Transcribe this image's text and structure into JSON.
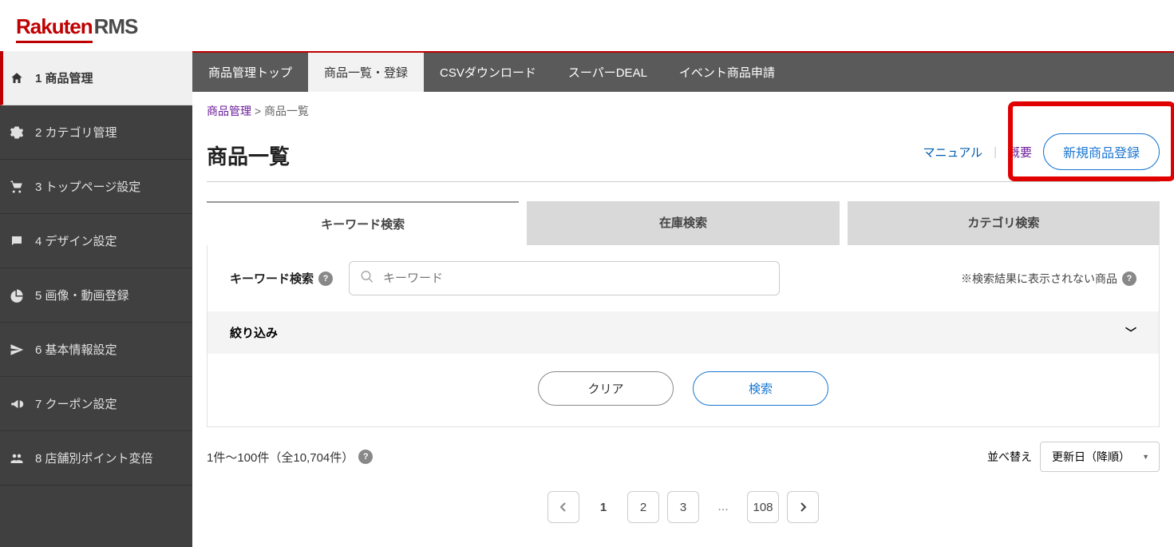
{
  "brand": {
    "name1": "Rakuten",
    "name2": "RMS"
  },
  "sidebar": {
    "items": [
      {
        "label": "1 商品管理",
        "icon": "home"
      },
      {
        "label": "2 カテゴリ管理",
        "icon": "gear"
      },
      {
        "label": "3 トップページ設定",
        "icon": "cart"
      },
      {
        "label": "4 デザイン設定",
        "icon": "comment"
      },
      {
        "label": "5 画像・動画登録",
        "icon": "pie"
      },
      {
        "label": "6 基本情報設定",
        "icon": "plane"
      },
      {
        "label": "7 クーポン設定",
        "icon": "megaphone"
      },
      {
        "label": "8 店舗別ポイント変倍",
        "icon": "users"
      }
    ]
  },
  "topnav": {
    "items": [
      {
        "label": "商品管理トップ"
      },
      {
        "label": "商品一覧・登録"
      },
      {
        "label": "CSVダウンロード"
      },
      {
        "label": "スーパーDEAL"
      },
      {
        "label": "イベント商品申請"
      }
    ]
  },
  "breadcrumb": {
    "parent": "商品管理",
    "sep": ">",
    "current": "商品一覧"
  },
  "page": {
    "title": "商品一覧",
    "link_manual": "マニュアル",
    "link_outline": "概要",
    "btn_new": "新規商品登録"
  },
  "tabs": [
    {
      "label": "キーワード検索"
    },
    {
      "label": "在庫検索"
    },
    {
      "label": "カテゴリ検索"
    }
  ],
  "search": {
    "label": "キーワード検索",
    "placeholder": "キーワード",
    "note": "※検索結果に表示されない商品"
  },
  "filter": {
    "label": "絞り込み"
  },
  "buttons": {
    "clear": "クリア",
    "search": "検索"
  },
  "results": {
    "count_text": "1件〜100件（全10,704件）",
    "sort_label": "並べ替え",
    "sort_value": "更新日（降順）"
  },
  "pagination": {
    "pages": [
      "1",
      "2",
      "3"
    ],
    "ellipsis": "...",
    "last": "108"
  }
}
